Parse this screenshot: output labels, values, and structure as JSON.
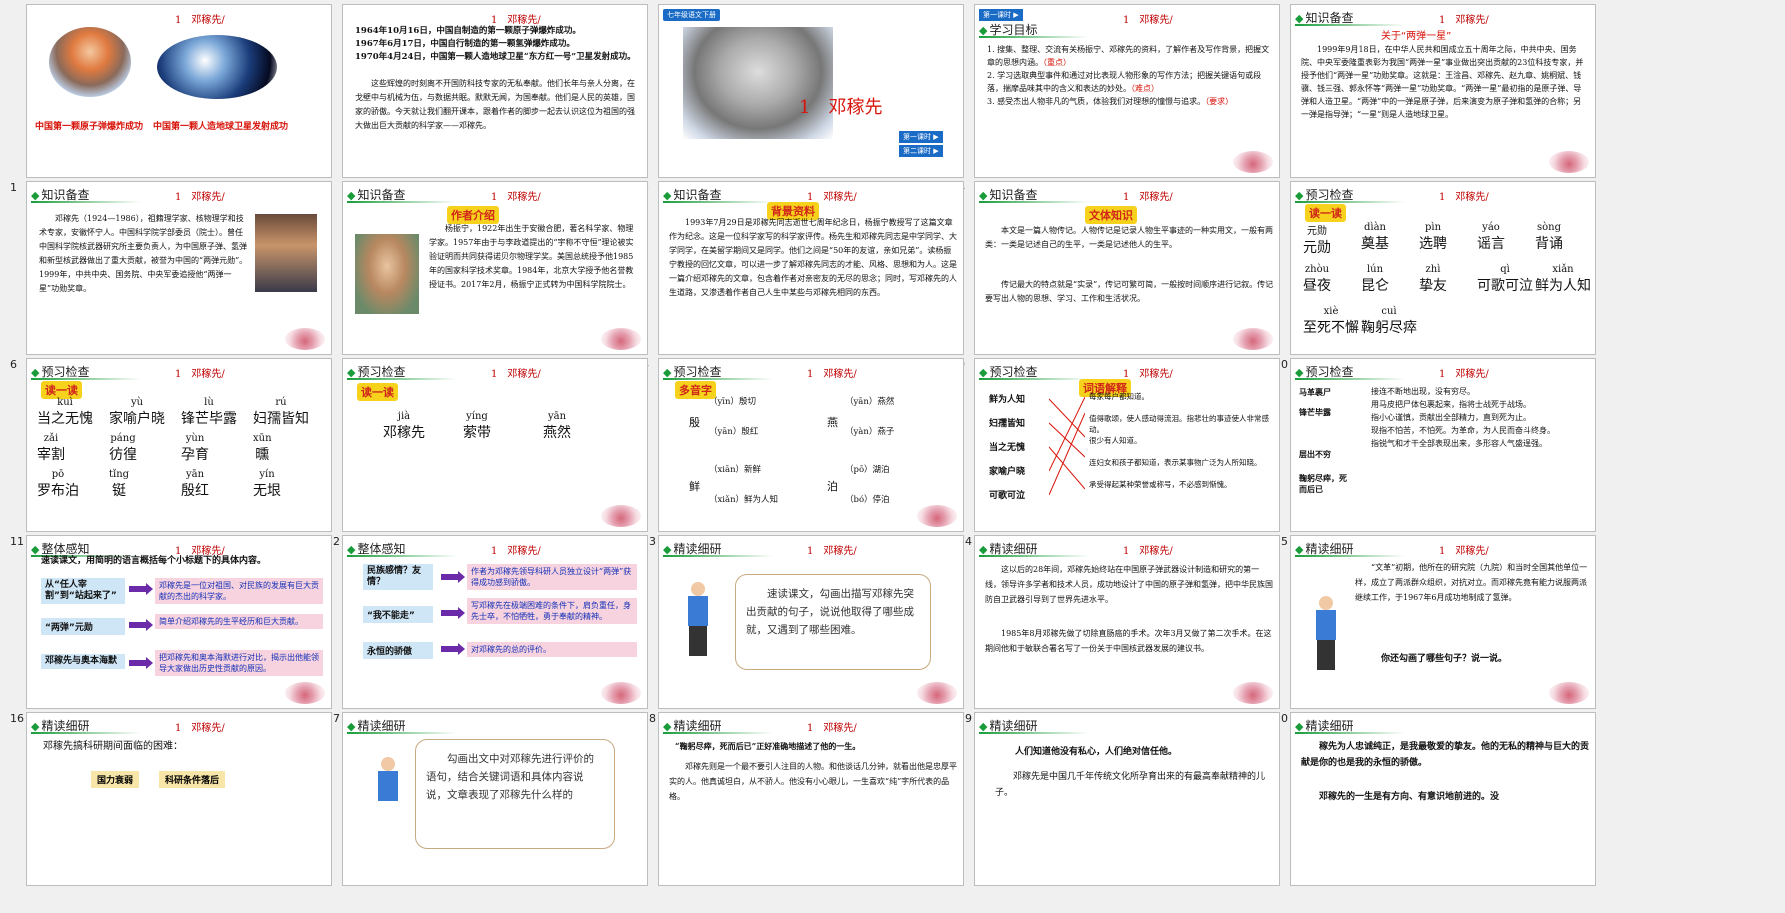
{
  "tag": "1　邓稼先/",
  "slides": [
    {
      "num": "1",
      "c1": "中国第一颗原子弹爆炸成功",
      "c2": "中国第一颗人造地球卫星发射成功"
    },
    {
      "num": "2",
      "l1": "1964年10月16日，中国自制造的第一颗原子弹爆炸成功。",
      "l2": "1967年6月17日，中国自行制造的第一颗氢弹爆炸成功。",
      "l3": "1970年4月24日，中国第一颗人造地球卫星“东方红一号”卫星发射成功。",
      "p": "这些辉煌的时刻离不开国防科技专家的无私奉献。他们长年与亲人分离，在戈壁中与机械为伍，与数据共眠。默默无闻，为国奉献。他们是人民的英雄，国家的骄傲。今天就让我们翻开课本，跟着作者的脚步一起去认识这位为祖国的强大做出巨大贡献的科学家——邓稼先。"
    },
    {
      "num": "3",
      "ribbon": "七年级语文下册",
      "title": "1　邓稼先",
      "b1": "第一课时 ▶",
      "b2": "第二课时 ▶"
    },
    {
      "num": "4",
      "badge": "第一课时 ▶",
      "h": "学习目标",
      "g1": "1. 搜集、整理、交流有关杨振宁、邓稼先的资料，了解作者及写作背景，把握文章的思想内涵。",
      "g1k": "（重点）",
      "g2": "2. 学习选取典型事件和通过对比表现人物形象的写作方法；把握关键语句或段落，揣摩品味其中的含义和表达的妙处。",
      "g2k": "（难点）",
      "g3": "3. 感受杰出人物非凡的气质，体验我们对理想的憧憬与追求。",
      "g3k": "（要求）"
    },
    {
      "num": "5",
      "h": "知识备查",
      "t": "关于“两弹一星”",
      "p": "1999年9月18日，在中华人民共和国成立五十周年之际，中共中央、国务院、中央军委隆重表彰为我国“两弹一星”事业做出突出贡献的23位科技专家，并授予他们“两弹一星”功勋奖章。这就是：王淦昌、邓稼先、赵九章、姚桐斌、钱骥、钱三强、郭永怀等“两弹一星”功勋奖章。“两弹一星”最初指的是原子弹、导弹和人造卫星。“两弹”中的一弹是原子弹，后来演变为原子弹和氢弹的合称；另一弹是指导弹；“一星”则是人造地球卫星。"
    },
    {
      "num": "6",
      "h": "知识备查",
      "p": "邓稼先（1924—1986），祖籍理学家、核物理学和技术专家，安徽怀宁人。中国科学院学部委员（院士）。曾任中国科学院核武器研究所主要负责人，为中国原子弹、氢弹和新型核武器做出了重大贡献，被誉为中国的“两弹元勋”。1999年，中共中央、国务院、中央军委追授他“两弹一星”功勋奖章。"
    },
    {
      "num": "7",
      "h": "知识备查",
      "badge": "作者介绍",
      "p": "杨振宁，1922年出生于安徽合肥，著名科学家、物理学家。1957年由于与李政道提出的“宇称不守恒”理论被实验证明而共同获得诺贝尔物理学奖。美国总统授予他1985年的国家科学技术奖章。1984年，北京大学授予他名誉教授证书。2017年2月，杨振宁正式转为中国科学院院士。",
      "hl": "“宇称不守恒”"
    },
    {
      "num": "8",
      "h": "知识备查",
      "badge": "背景资料",
      "p": "1993年7月29日是邓稼先同志逝世七周年纪念日，杨振宁教授写了这篇文章作为纪念。这是一位科学家写的科学家评传。杨先生和邓稼先同志是中学同学、大学同学，在美留学期间又是同学。他们之间是“50年的友谊，亲如兄弟”。读杨振宁教授的回忆文章，可以进一步了解邓稼先同志的才能、风格、思想和为人。这是一篇介绍邓稼先的文章，包含着作者对亲密友的无尽的思念；同时，写邓稼先的人生道路，又渗透着作者自己人生中某些与邓稼先相同的东西。"
    },
    {
      "num": "9",
      "h": "知识备查",
      "badge": "文体知识",
      "p1": "本文是一篇人物传记。人物传记是记录人物生平事迹的一种实用文，一般有两类：一类是记述自己的生平，一类是记述他人的生平。",
      "p2": "传记最大的特点就是“实录”，传记可繁可简，一般按时间顺序进行记叙。传记要写出人物的思想、学习、工作和生活状况。"
    },
    {
      "num": "10",
      "h": "预习检查",
      "badge": "读一读",
      "items": [
        {
          "p": "元勋",
          "c": "元勋"
        },
        {
          "p": "dìàn",
          "c": "奠基"
        },
        {
          "p": "pìn",
          "c": "选聘"
        },
        {
          "p": "yáo",
          "c": "谣言"
        },
        {
          "p": "sòng",
          "c": "背诵"
        },
        {
          "p": "zhòu",
          "c": "昼夜"
        },
        {
          "p": "lún",
          "c": "昆仑"
        },
        {
          "p": "zhì",
          "c": "挚友"
        },
        {
          "p": "qì",
          "c": "可歌可泣"
        },
        {
          "p": "xiǎn",
          "c": "鲜为人知"
        },
        {
          "p": "xiè",
          "c": "至死不懈"
        },
        {
          "p": "cuì",
          "c": "鞠躬尽瘁"
        }
      ]
    },
    {
      "num": "11",
      "h": "预习检查",
      "badge": "读一读",
      "items": [
        {
          "p": "kuì",
          "c": "当之无愧"
        },
        {
          "p": "yù",
          "c": "家喻户晓"
        },
        {
          "p": "lù",
          "c": "锋芒毕露"
        },
        {
          "p": "rú",
          "c": "妇孺皆知"
        },
        {
          "p": "zǎi",
          "c": "宰割"
        },
        {
          "p": "páng",
          "c": "彷徨"
        },
        {
          "p": "yùn",
          "c": "孕育"
        },
        {
          "p": "xūn",
          "c": "曛"
        },
        {
          "p": "pō",
          "c": "罗布泊"
        },
        {
          "p": "tǐng",
          "c": "铤"
        },
        {
          "p": "yān",
          "c": "殷红"
        },
        {
          "p": "yín",
          "c": "无垠"
        }
      ]
    },
    {
      "num": "12",
      "h": "预习检查",
      "badge": "读一读",
      "items": [
        {
          "p": "jià",
          "c": "邓稼先"
        },
        {
          "p": "yíng",
          "c": "萦带"
        },
        {
          "p": "yān",
          "c": "燕然"
        }
      ]
    },
    {
      "num": "13",
      "h": "预习检查",
      "badge": "多音字",
      "a": "殷",
      "a1": "（yīn）殷切",
      "a2": "（yān）殷红",
      "b": "燕",
      "b1": "（yān）燕然",
      "b2": "（yàn）燕子",
      "c": "鲜",
      "c1": "（xiān）新鲜",
      "c2": "（xiǎn）鲜为人知",
      "d": "泊",
      "d1": "（pō）湖泊",
      "d2": "（bó）停泊"
    },
    {
      "num": "14",
      "h": "预习检查",
      "badge": "词语解释",
      "left": [
        "鲜为人知",
        "妇孺皆知",
        "当之无愧",
        "家喻户晓",
        "可歌可泣"
      ],
      "right": [
        "每家每户都知道。",
        "值得歌颂，使人感动得流泪。指悲壮的事迹使人非常感动。",
        "很少有人知道。",
        "连妇女和孩子都知道，表示某事物广泛为人所知晓。",
        "承受得起某种荣誉或称号，不必感到惭愧。"
      ]
    },
    {
      "num": "15",
      "h": "预习检查",
      "left": [
        "马革裹尸",
        "锋芒毕露",
        "",
        "鞠躬尽瘁，死而后已"
      ],
      "right": [
        "接连不断地出现，没有穷尽。",
        "用马皮把尸体包裹起来，指将士战死于战场。",
        "指小心谨慎，贡献出全部精力，直到死为止。",
        "现指不怕苦，不怕死。为革命，为人民而奋斗终身。",
        "指锐气和才干全部表现出来，多形容人气盛逞强。"
      ],
      "l3": "层出不穷"
    },
    {
      "num": "16",
      "h": "整体感知",
      "intro": "速读课文，用简明的语言概括每个小标题下的具体内容。",
      "rows": [
        {
          "l": "从“任人宰割”到“站起来了”",
          "r": "邓稼先是一位对祖国、对民族的发展有巨大贡献的杰出的科学家。"
        },
        {
          "l": "“两弹”元勋",
          "r": "简单介绍邓稼先的生平经历和巨大贡献。"
        },
        {
          "l": "邓稼先与奥本海默",
          "r": "把邓稼先和奥本海默进行对比，揭示出他能领导大家做出历史性贡献的原因。"
        }
      ]
    },
    {
      "num": "17",
      "h": "整体感知",
      "rows": [
        {
          "l": "民族感情？友情？",
          "r": "作者为邓稼先领导科研人员独立设计“两弹”获得成功感到骄傲。"
        },
        {
          "l": "“我不能走”",
          "r": "写邓稼先在极端困难的条件下，肩负重任，身先士卒，不怕牺牲，勇于奉献的精神。"
        },
        {
          "l": "永恒的骄傲",
          "r": "对邓稼先的总的评价。"
        }
      ]
    },
    {
      "num": "18",
      "h": "精读细研",
      "q": "速读课文，勾画出描写邓稼先突出贡献的句子，说说他取得了哪些成就，又遇到了哪些困难。"
    },
    {
      "num": "19",
      "h": "精读细研",
      "p1": "这以后的28年间，邓稼先始终站在中国原子弹武器设计制造和研究的第一线，领导许多学者和技术人员，成功地设计了中国的原子弹和氢弹，把中华民族国防自卫武器引导到了世界先进水平。",
      "p2": "1985年8月邓稼先做了切除直肠癌的手术。次年3月又做了第二次手术。在这期间他和于敏联合署名写了一份关于中国核武器发展的建议书。"
    },
    {
      "num": "20",
      "h": "精读细研",
      "p": "“文革”初期，他所在的研究院（九院）和当时全国其他单位一样，成立了两派群众组织，对抗对立。而邓稼先竟有能力说服两派继续工作，于1967年6月成功地制成了氢弹。",
      "q": "你还勾画了哪些句子？说一说。"
    },
    {
      "num": "",
      "h": "精读细研",
      "intro": "邓稼先搞科研期间面临的困难：",
      "b1": "国力衰弱",
      "b2": "科研条件落后"
    },
    {
      "num": "",
      "h": "精读细研",
      "q": "勾画出文中对邓稼先进行评价的语句，结合关键词语和具体内容说说，文章表现了邓稼先什么样的"
    },
    {
      "num": "",
      "h": "精读细研",
      "p1": "“鞠躬尽瘁，死而后已”正好准确地描述了他的一生。",
      "p2": "邓稼先则是一个最不要引人注目的人物。和他谈话几分钟，就看出他是忠厚平实的人。他真诚坦白，从不骄人。他没有小心眼儿，一生喜欢“纯”字所代表的品格。"
    },
    {
      "num": "",
      "h": "精读细研",
      "p1": "人们知道他没有私心，人们绝对信任他。",
      "p2": "邓稼先是中国几千年传统文化所孕育出来的有最高奉献精神的儿子。"
    },
    {
      "num": "",
      "h": "精读细研",
      "p1": "稼先为人忠诚纯正，是我最敬爱的挚友。他的无私的精神与巨大的贡献是你的也是我的永恒的骄傲。",
      "p2": "邓稼先的一生是有方向、有意识地前进的。没"
    }
  ]
}
